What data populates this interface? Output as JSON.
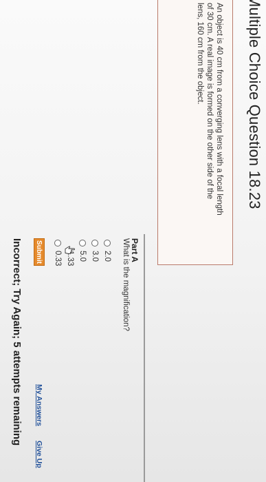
{
  "header": {
    "title": "Multiple Choice Question 18.23"
  },
  "question": {
    "line1": "An object is 40 cm from a converging lens with a focal length",
    "line2": "of 30 cm. A real image is formed on the other side of the",
    "line3": "lens, 160 cm from the object."
  },
  "part": {
    "label": "Part A",
    "prompt": "What is the magnification?"
  },
  "choices": [
    {
      "label": "2.0"
    },
    {
      "label": "3.0"
    },
    {
      "label": "5.0"
    },
    {
      "label": "1.33"
    },
    {
      "label": "0.33"
    }
  ],
  "actions": {
    "submit": "Submit",
    "my_answers": "My Answers",
    "give_up": "Give Up"
  },
  "feedback": "Incorrect; Try Again; 5 attempts remaining"
}
